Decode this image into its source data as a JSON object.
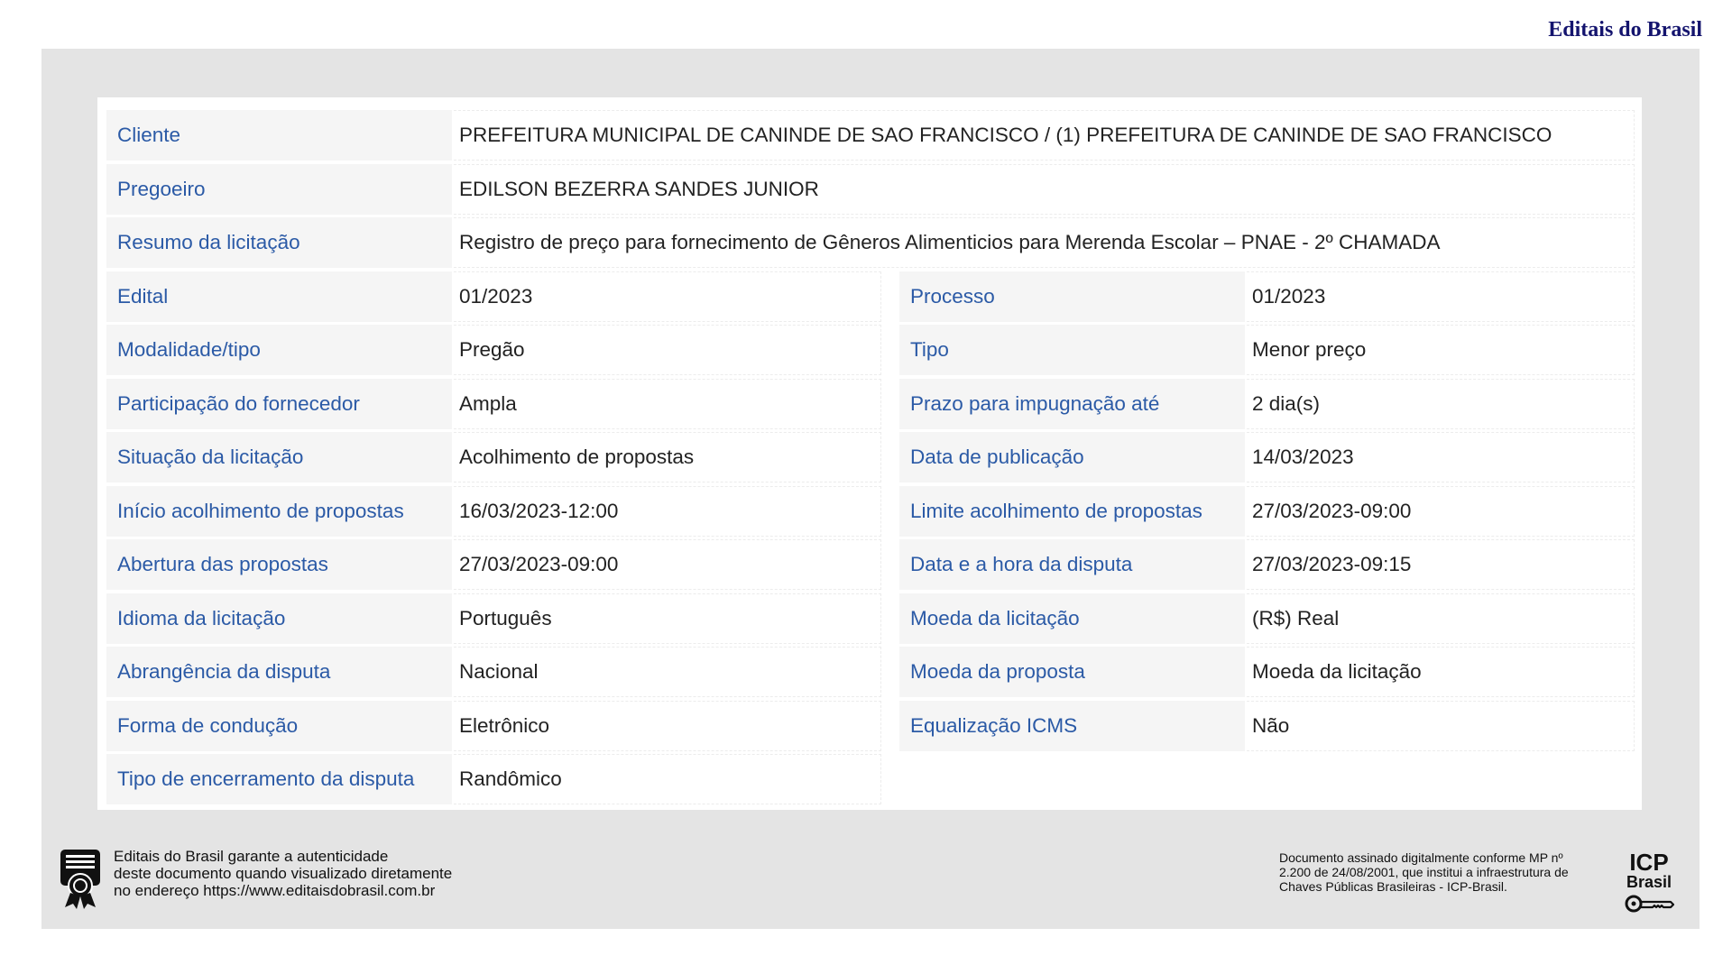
{
  "header": {
    "brand": "Editais do Brasil"
  },
  "fields": {
    "cliente": {
      "label": "Cliente",
      "value": "PREFEITURA MUNICIPAL DE CANINDE DE SAO FRANCISCO  / (1)  PREFEITURA DE CANINDE DE SAO FRANCISCO"
    },
    "pregoeiro": {
      "label": "Pregoeiro",
      "value": "EDILSON BEZERRA SANDES JUNIOR"
    },
    "resumo": {
      "label": "Resumo da licitação",
      "value": "Registro de preço para fornecimento de Gêneros Alimenticios para Merenda Escolar – PNAE - 2º CHAMADA"
    },
    "edital": {
      "label": "Edital",
      "value": "01/2023"
    },
    "processo": {
      "label": "Processo",
      "value": "01/2023"
    },
    "modalidade": {
      "label": "Modalidade/tipo",
      "value": "Pregão"
    },
    "tipo": {
      "label": "Tipo",
      "value": "Menor preço"
    },
    "participacao": {
      "label": "Participação do fornecedor",
      "value": "Ampla"
    },
    "prazo": {
      "label": "Prazo para impugnação até",
      "value": "2 dia(s)"
    },
    "situacao": {
      "label": "Situação da licitação",
      "value": "Acolhimento de propostas"
    },
    "publicacao": {
      "label": "Data de publicação",
      "value": "14/03/2023"
    },
    "inicio": {
      "label": "Início acolhimento de propostas",
      "value": "16/03/2023-12:00"
    },
    "limite": {
      "label": "Limite acolhimento de propostas",
      "value": "27/03/2023-09:00"
    },
    "abertura": {
      "label": "Abertura das propostas",
      "value": "27/03/2023-09:00"
    },
    "disputa_data": {
      "label": "Data e a hora da disputa",
      "value": "27/03/2023-09:15"
    },
    "idioma": {
      "label": "Idioma da licitação",
      "value": "Português"
    },
    "moeda_licitacao": {
      "label": "Moeda da licitação",
      "value": "(R$) Real"
    },
    "abrangencia": {
      "label": "Abrangência da disputa",
      "value": "Nacional"
    },
    "moeda_proposta": {
      "label": "Moeda da proposta",
      "value": "Moeda da licitação"
    },
    "conducao": {
      "label": "Forma de condução",
      "value": "Eletrônico"
    },
    "icms": {
      "label": "Equalização ICMS",
      "value": "Não"
    },
    "encerramento": {
      "label": "Tipo de encerramento da disputa",
      "value": "Randômico"
    }
  },
  "footer": {
    "auth_line1": "Editais do Brasil garante a autenticidade",
    "auth_line2": "deste documento quando visualizado diretamente",
    "auth_line3": "no endereço https://www.editaisdobrasil.com.br",
    "sig_line1": "Documento assinado digitalmente conforme MP nº",
    "sig_line2": "2.200 de 24/08/2001, que institui a infraestrutura de",
    "sig_line3": "Chaves Públicas Brasileiras - ICP-Brasil.",
    "icp_top": "ICP",
    "icp_bottom": "Brasil"
  },
  "icons": {
    "seal": "certificate-seal-icon",
    "key": "key-icon"
  },
  "colors": {
    "label": "#2b5aa6",
    "brand": "#14146e",
    "frame": "#e4e4e4"
  }
}
